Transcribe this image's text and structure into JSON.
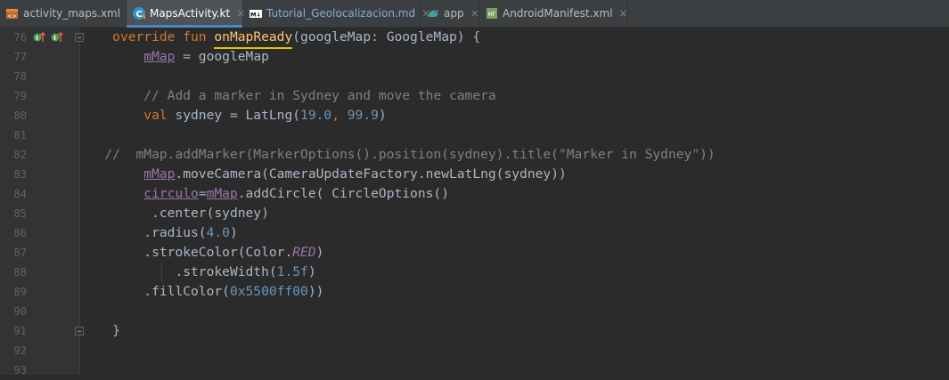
{
  "tabs": [
    {
      "label": "activity_maps.xml",
      "icon": "layout-xml-icon",
      "active": false
    },
    {
      "label": "MapsActivity.kt",
      "icon": "kotlin-class-icon",
      "active": true
    },
    {
      "label": "Tutorial_Geolocalizacion.md",
      "icon": "markdown-icon",
      "active": false
    },
    {
      "label": "app",
      "icon": "android-module-icon",
      "active": false
    },
    {
      "label": "AndroidManifest.xml",
      "icon": "manifest-icon",
      "active": false
    }
  ],
  "close_glyph": "×",
  "gutter": {
    "line_numbers": [
      "76",
      "77",
      "78",
      "79",
      "80",
      "81",
      "82",
      "83",
      "84",
      "85",
      "86",
      "87",
      "88",
      "89",
      "90",
      "91",
      "92",
      "93"
    ]
  },
  "code": {
    "l76": {
      "p1": "override fun ",
      "fn": "onMapReady",
      "p2": "(googleMap: GoogleMap) {"
    },
    "l77": {
      "prop": "mMap",
      "p2": " = googleMap"
    },
    "l79": {
      "cmt": "// Add a marker in Sydney and move the camera"
    },
    "l80": {
      "kw": "val",
      "p1": " sydney = LatLng(",
      "n1": "19.0",
      "p2": ", ",
      "n2": "99.9",
      "p3": ")"
    },
    "l82": {
      "cmt": "//  mMap.addMarker(MarkerOptions().position(sydney).title(\"Marker in Sydney\"))"
    },
    "l83": {
      "prop": "mMap",
      "p2": ".moveCamera(CameraUpdateFactory.newLatLng(sydney))"
    },
    "l84": {
      "prop1": "circulo",
      "eq": "=",
      "prop2": "mMap",
      "p2": ".addCircle( CircleOptions()"
    },
    "l85": {
      "p1": ".center(sydney)"
    },
    "l86": {
      "p1": ".radius(",
      "n1": "4.0",
      "p2": ")"
    },
    "l87": {
      "p1": ".strokeColor(Color.",
      "c1": "RED",
      "p2": ")"
    },
    "l88": {
      "p1": ".strokeWidth(",
      "n1": "1.5f",
      "p2": ")"
    },
    "l89": {
      "p1": ".fillColor(",
      "n1": "0x5500ff00",
      "p2": "))"
    },
    "l91": {
      "p1": "}"
    }
  },
  "colors": {
    "background": "#2b2b2b",
    "keyword": "#cc7832",
    "function": "#ffc66d",
    "number": "#6897bb",
    "comment": "#808080",
    "property": "#9876aa",
    "default": "#a9b7c6"
  }
}
